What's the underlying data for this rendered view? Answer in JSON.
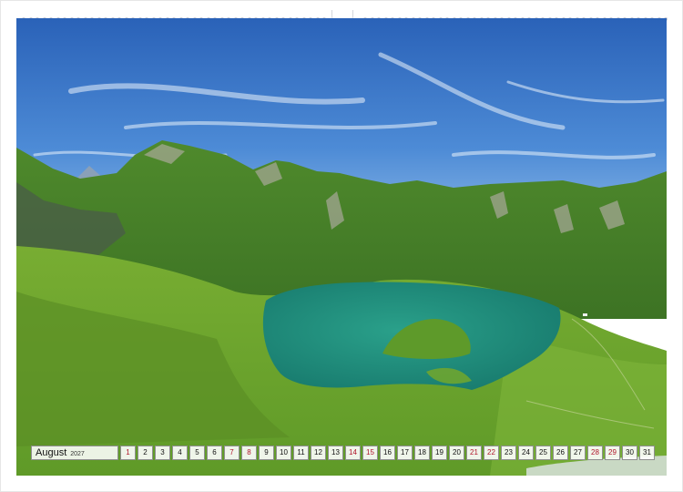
{
  "calendar": {
    "month": "August",
    "year": "2027",
    "days": [
      "1",
      "2",
      "3",
      "4",
      "5",
      "6",
      "7",
      "8",
      "9",
      "10",
      "11",
      "12",
      "13",
      "14",
      "15",
      "16",
      "17",
      "18",
      "19",
      "20",
      "21",
      "22",
      "23",
      "24",
      "25",
      "26",
      "27",
      "28",
      "29",
      "30",
      "31"
    ],
    "highlighted_days": [
      "1",
      "7",
      "8",
      "14",
      "15",
      "21",
      "22",
      "28",
      "29"
    ],
    "highlight_color": "#b0142a"
  },
  "photo": {
    "subject": "alpine lake landscape",
    "colors": {
      "sky": "#2f6fc0",
      "meadow": "#6fa62d",
      "lake": "#1f8f7e"
    }
  }
}
